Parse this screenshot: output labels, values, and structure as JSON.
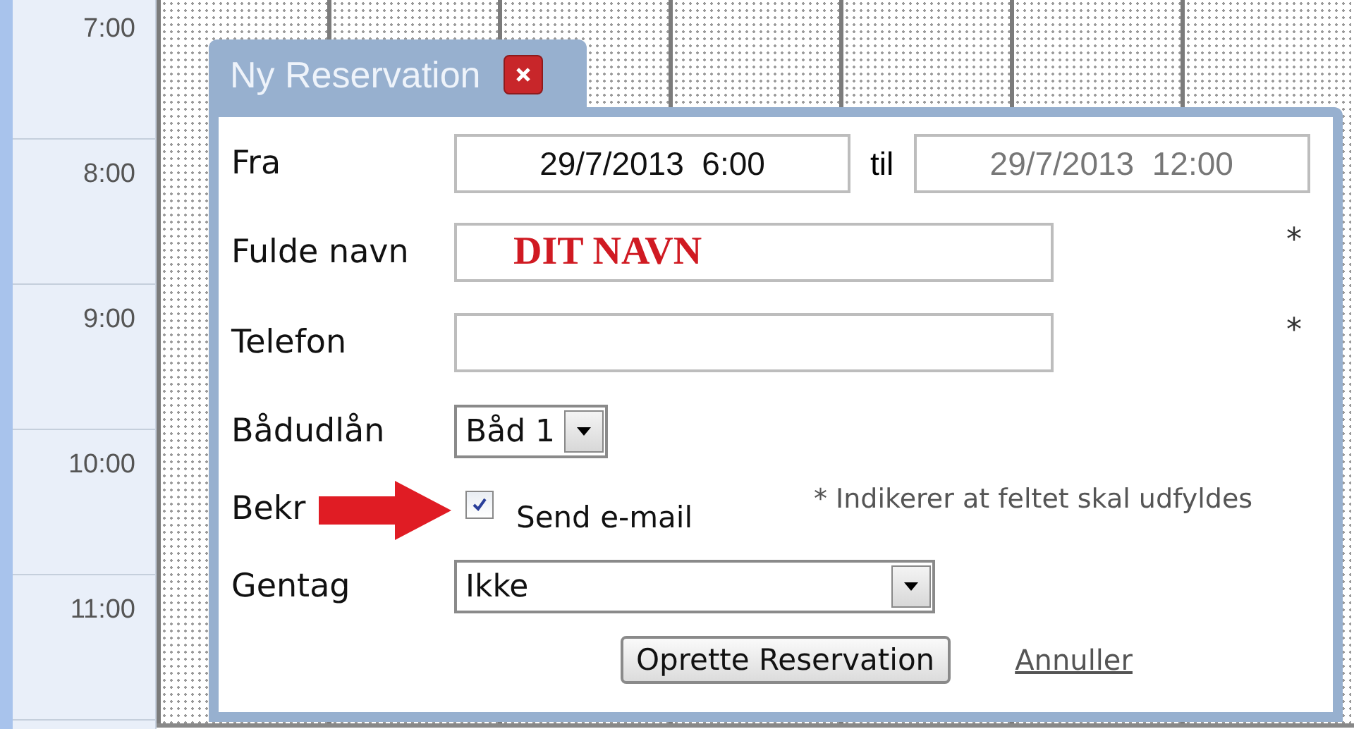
{
  "calendar": {
    "times": [
      "7:00",
      "8:00",
      "9:00",
      "10:00",
      "11:00"
    ]
  },
  "dialog": {
    "title": "Ny Reservation",
    "rows": [
      {
        "kind": "range",
        "label": "Fra",
        "from": {
          "value": "29/7/2013  6:00",
          "disabled": false
        },
        "separator": "til",
        "to": {
          "value": "29/7/2013  12:00",
          "disabled": true
        }
      },
      {
        "kind": "text",
        "label": "Fulde navn",
        "value": "DIT NAVN",
        "required_mark": "*"
      },
      {
        "kind": "text",
        "label": "Telefon",
        "required_mark": "*"
      },
      {
        "kind": "select",
        "label": "Bådudlån",
        "value": "Båd 1"
      },
      {
        "kind": "checkbox",
        "label": "Bekr",
        "checked": true,
        "text": "Send e-mail",
        "note": "* Indikerer at feltet skal udfyldes"
      },
      {
        "kind": "select",
        "label": "Gentag",
        "value": "Ikke"
      }
    ],
    "submit": "Oprette Reservation",
    "cancel": "Annuller"
  }
}
